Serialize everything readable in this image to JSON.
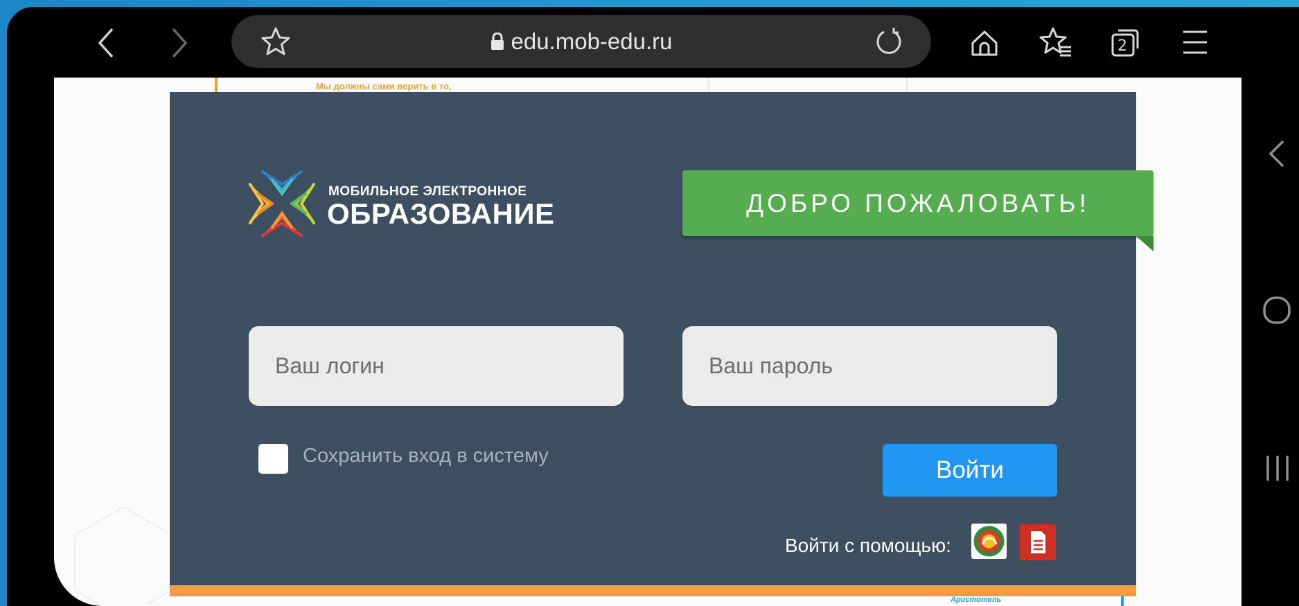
{
  "browser": {
    "url": "edu.mob-edu.ru",
    "tab_count": "2",
    "icons": [
      "back-icon",
      "forward-icon",
      "star-icon",
      "lock-icon",
      "reload-icon",
      "home-icon",
      "bookmarks-icon",
      "tabs-icon",
      "menu-icon"
    ]
  },
  "background_page": {
    "quote_text": "Мы должны сами верить в то,",
    "author": "Аристотель"
  },
  "brand": {
    "line1": "МОБИЛЬНОЕ ЭЛЕКТРОННОЕ",
    "line2": "ОБРАЗОВАНИЕ"
  },
  "welcome": "ДОБРО ПОЖАЛОВАТЬ!",
  "form": {
    "login_placeholder": "Ваш логин",
    "password_placeholder": "Ваш пароль",
    "remember_label": "Сохранить вход в систему",
    "remember_checked": false,
    "submit_label": "Войти",
    "alt_login_label": "Войти с помощью:"
  },
  "colors": {
    "card": "#3c4e5f",
    "welcome": "#55ad4f",
    "button": "#2196f3",
    "accent_bar": "#f29a3d",
    "doc_button": "#d02f24"
  },
  "android_nav": [
    "back-icon",
    "home-icon",
    "recents-icon"
  ]
}
